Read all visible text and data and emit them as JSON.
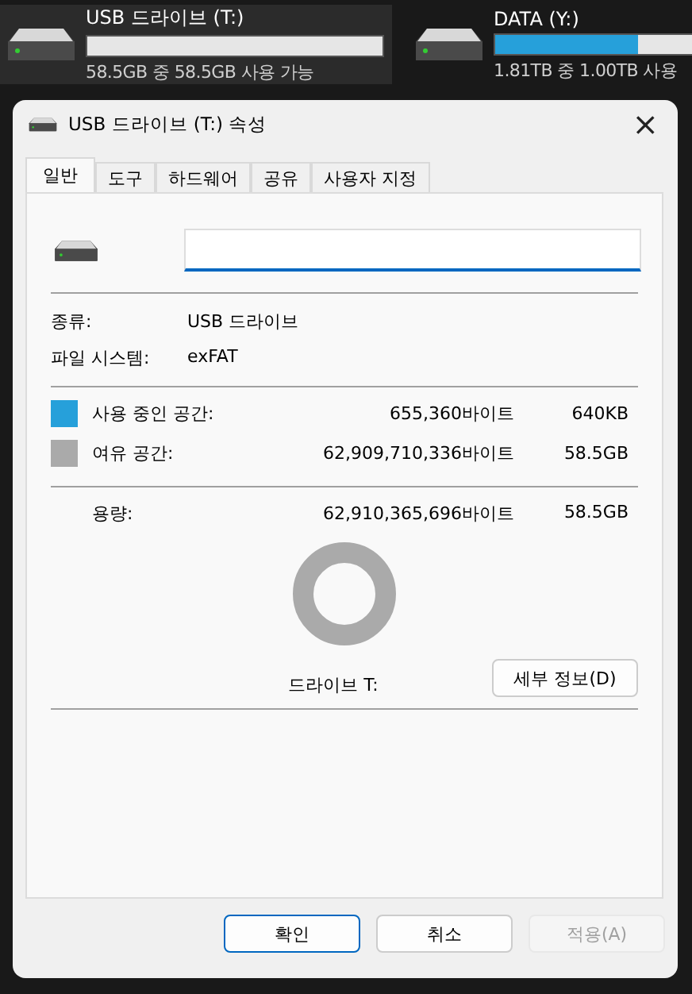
{
  "drives": [
    {
      "name": "USB 드라이브 (T:)",
      "level": 0.0,
      "usage": "58.5GB 중 58.5GB 사용 가능",
      "selected": true
    },
    {
      "name": "DATA (Y:)",
      "level": 0.45,
      "usage": "1.81TB 중 1.00TB 사용",
      "selected": false
    }
  ],
  "window": {
    "title": "USB 드라이브 (T:) 속성",
    "close": "×"
  },
  "tabs": [
    {
      "label": "일반",
      "selected": true
    },
    {
      "label": "도구",
      "selected": false
    },
    {
      "label": "하드웨어",
      "selected": false
    },
    {
      "label": "공유",
      "selected": false
    },
    {
      "label": "사용자 지정",
      "selected": false
    }
  ],
  "general": {
    "info": [
      {
        "label": "종류:",
        "value": "USB 드라이브"
      },
      {
        "label": "파일 시스템:",
        "value": "exFAT"
      }
    ],
    "space": [
      {
        "label": "사용 중인 공간:",
        "bytes": "655,360바이트",
        "size": "640KB",
        "color": "#26a0da"
      },
      {
        "label": "여유 공간:",
        "bytes": "62,909,710,336바이트",
        "size": "58.5GB",
        "color": "#aaaaaa"
      }
    ],
    "capacity": {
      "label": "용량:",
      "bytes": "62,910,365,696바이트",
      "size": "58.5GB"
    },
    "drive_label": "드라이브 T:",
    "details_button": "세부 정보(D)"
  },
  "buttons": [
    {
      "label": "확인",
      "kind": "default",
      "disabled": false
    },
    {
      "label": "취소",
      "kind": "normal",
      "disabled": false
    },
    {
      "label": "적용(A)",
      "kind": "normal",
      "disabled": true
    }
  ]
}
